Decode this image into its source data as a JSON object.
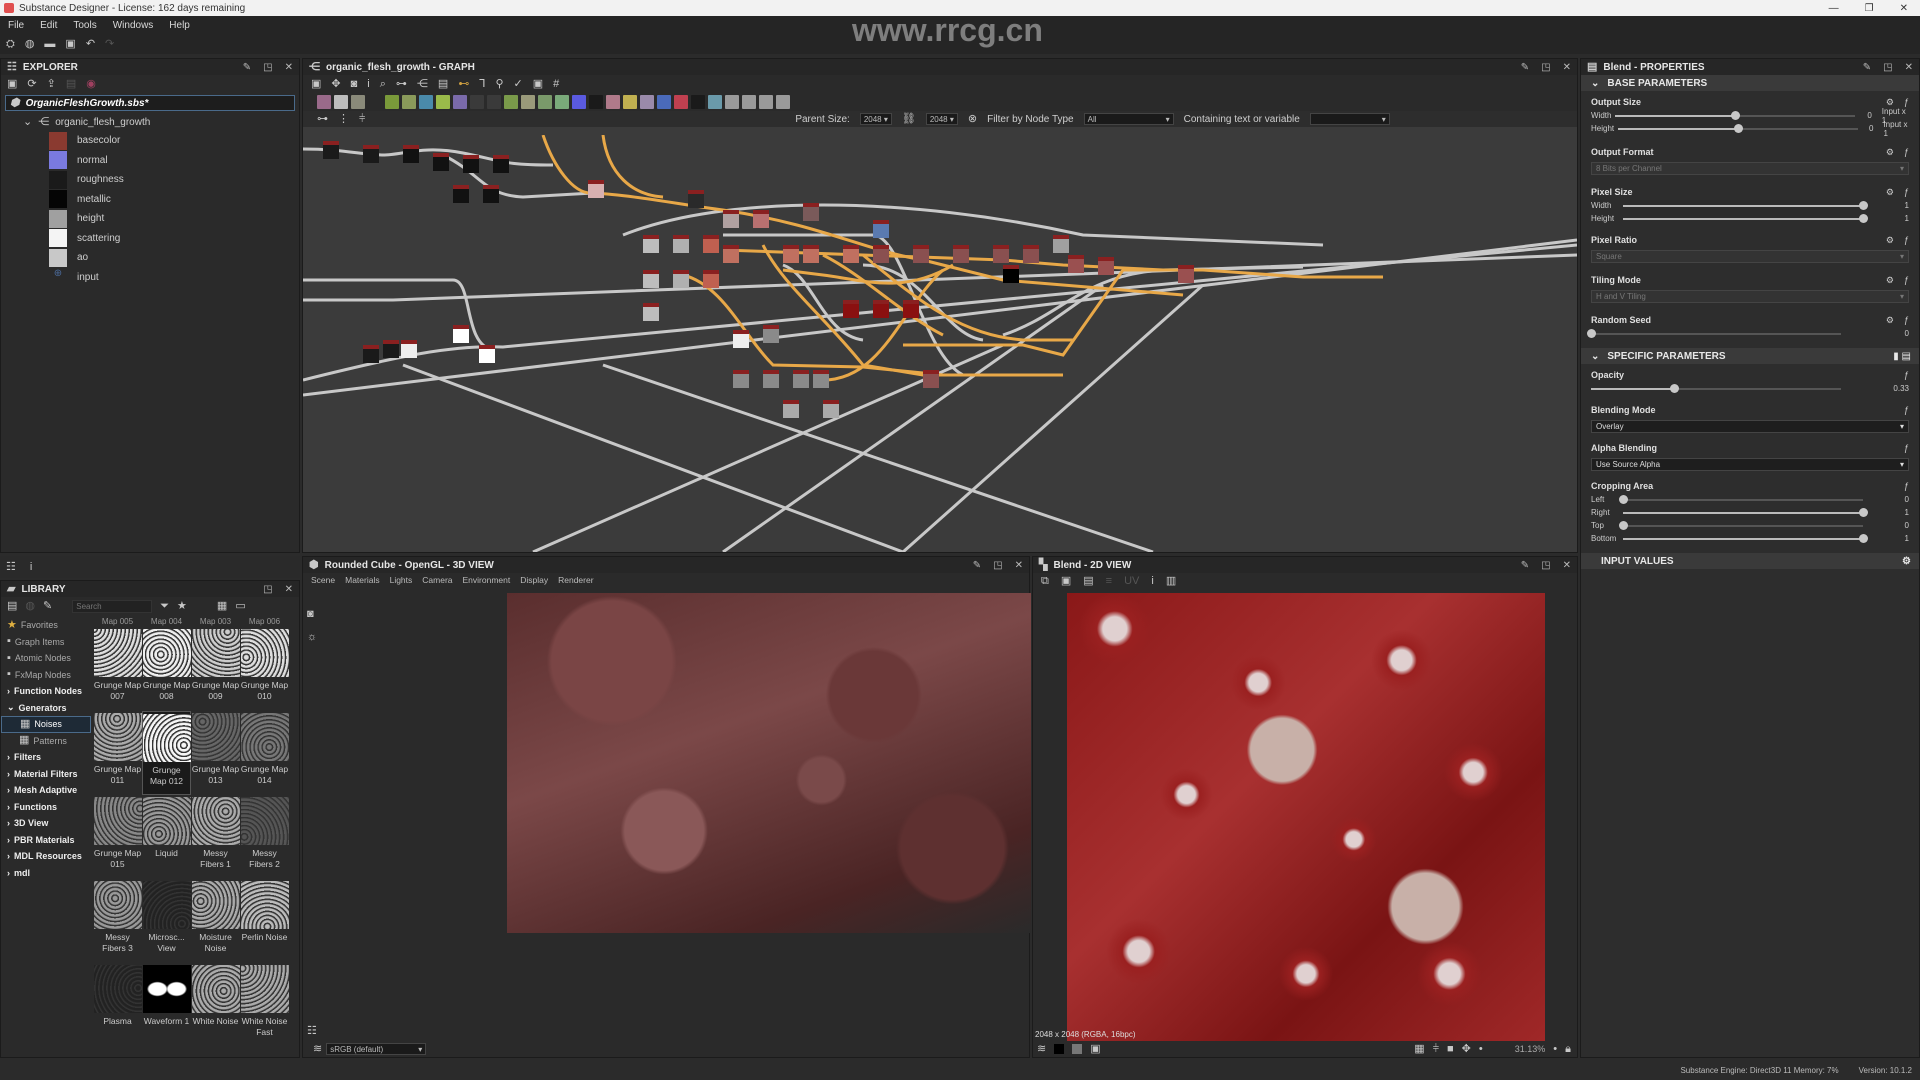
{
  "window": {
    "title": "Substance Designer - License: 162 days remaining"
  },
  "menu": [
    "File",
    "Edit",
    "Tools",
    "Windows",
    "Help"
  ],
  "watermark": "www.rrcg.cn",
  "explorer": {
    "title": "EXPLORER",
    "package": "OrganicFleshGrowth.sbs*",
    "graph": "organic_flesh_growth",
    "outputs": [
      {
        "label": "basecolor",
        "color": "#8a3a30"
      },
      {
        "label": "normal",
        "color": "#7a7ae0"
      },
      {
        "label": "roughness",
        "color": "#1a1a1a"
      },
      {
        "label": "metallic",
        "color": "#050505"
      },
      {
        "label": "height",
        "color": "#a0a0a0"
      },
      {
        "label": "scattering",
        "color": "#f4f4f4"
      },
      {
        "label": "ao",
        "color": "#c8c8c8"
      },
      {
        "label": "input",
        "color": "#4a6a9a"
      }
    ]
  },
  "graph": {
    "title": "organic_flesh_growth - GRAPH",
    "parent_size_label": "Parent Size:",
    "parent_size_w": "2048",
    "parent_size_h": "2048",
    "filter_label": "Filter by Node Type",
    "filter_value": "All",
    "containing_label": "Containing text or variable",
    "containing_value": ""
  },
  "properties": {
    "title": "Blend - PROPERTIES",
    "base_section": "BASE PARAMETERS",
    "output_size": {
      "label": "Output Size",
      "width_label": "Width",
      "height_label": "Height",
      "width_value": "0",
      "height_value": "0",
      "width_mode": "Input x 1",
      "height_mode": "Input x 1",
      "width_pos": 0.5,
      "height_pos": 0.5
    },
    "output_format": {
      "label": "Output Format",
      "value": "8 Bits per Channel"
    },
    "pixel_size": {
      "label": "Pixel Size",
      "width_label": "Width",
      "height_label": "Height",
      "width_value": "1",
      "height_value": "1"
    },
    "pixel_ratio": {
      "label": "Pixel Ratio",
      "value": "Square"
    },
    "tiling_mode": {
      "label": "Tiling Mode",
      "value": "H and V Tiling"
    },
    "random_seed": {
      "label": "Random Seed",
      "value": "0"
    },
    "specific_section": "SPECIFIC PARAMETERS",
    "opacity": {
      "label": "Opacity",
      "value": "0.33",
      "pos": 0.33
    },
    "blending_mode": {
      "label": "Blending Mode",
      "value": "Overlay"
    },
    "alpha_blending": {
      "label": "Alpha Blending",
      "value": "Use Source Alpha"
    },
    "cropping": {
      "label": "Cropping Area",
      "left_label": "Left",
      "right_label": "Right",
      "top_label": "Top",
      "bottom_label": "Bottom",
      "left": "0",
      "right": "1",
      "top": "0",
      "bottom": "1"
    },
    "input_section": "INPUT VALUES"
  },
  "library": {
    "title": "LIBRARY",
    "search_placeholder": "Search",
    "categories": [
      {
        "label": "Favorites",
        "type": "top"
      },
      {
        "label": "Graph Items",
        "type": "top"
      },
      {
        "label": "Atomic Nodes",
        "type": "top"
      },
      {
        "label": "FxMap Nodes",
        "type": "top"
      },
      {
        "label": "Function Nodes",
        "type": "bold"
      },
      {
        "label": "Generators",
        "type": "bold-open"
      },
      {
        "label": "Noises",
        "type": "sub-selected"
      },
      {
        "label": "Patterns",
        "type": "sub"
      },
      {
        "label": "Filters",
        "type": "bold"
      },
      {
        "label": "Material Filters",
        "type": "bold"
      },
      {
        "label": "Mesh Adaptive",
        "type": "bold"
      },
      {
        "label": "Functions",
        "type": "bold"
      },
      {
        "label": "3D View",
        "type": "bold"
      },
      {
        "label": "PBR Materials",
        "type": "bold"
      },
      {
        "label": "MDL Resources",
        "type": "bold"
      },
      {
        "label": "mdl",
        "type": "bold"
      }
    ],
    "partial_row": [
      "Map 005",
      "Map 004",
      "Map 003",
      "Map 006"
    ],
    "tiles": [
      {
        "label": "Grunge Map 007"
      },
      {
        "label": "Grunge Map 008"
      },
      {
        "label": "Grunge Map 009"
      },
      {
        "label": "Grunge Map 010"
      },
      {
        "label": "Grunge Map 011"
      },
      {
        "label": "Grunge Map 012",
        "selected": true
      },
      {
        "label": "Grunge Map 013"
      },
      {
        "label": "Grunge Map 014"
      },
      {
        "label": "Grunge Map 015"
      },
      {
        "label": "Liquid"
      },
      {
        "label": "Messy Fibers 1"
      },
      {
        "label": "Messy Fibers 2"
      },
      {
        "label": "Messy Fibers 3"
      },
      {
        "label": "Microsc... View"
      },
      {
        "label": "Moisture Noise"
      },
      {
        "label": "Perlin Noise"
      },
      {
        "label": "Plasma"
      },
      {
        "label": "Waveform 1"
      },
      {
        "label": "White Noise"
      },
      {
        "label": "White Noise Fast"
      }
    ]
  },
  "view3d": {
    "title": "Rounded Cube - OpenGL - 3D VIEW",
    "menu": [
      "Scene",
      "Materials",
      "Lights",
      "Camera",
      "Environment",
      "Display",
      "Renderer"
    ],
    "colorspace": "sRGB (default)"
  },
  "view2d": {
    "title": "Blend - 2D VIEW",
    "info": "2048 x 2048 (RGBA, 16bpc)",
    "zoom": "31.13%"
  },
  "status": {
    "engine": "Substance Engine: Direct3D 11  Memory: 7%",
    "version": "Version: 10.1.2"
  }
}
